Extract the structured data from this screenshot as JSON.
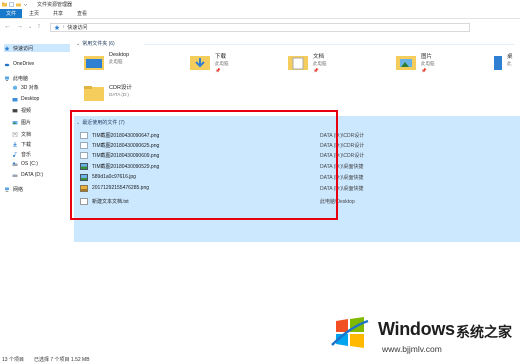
{
  "window": {
    "title": "文件资源管理器"
  },
  "ribbon": {
    "tabs": [
      "文件",
      "主页",
      "共享",
      "查看"
    ]
  },
  "address": {
    "root": "快速访问"
  },
  "sidebar": {
    "items": [
      {
        "label": "快速访问",
        "icon": "star-icon"
      },
      {
        "label": "OneDrive",
        "icon": "cloud-icon"
      },
      {
        "label": "此电脑",
        "icon": "computer-icon"
      },
      {
        "label": "3D 对象",
        "icon": "cube-icon"
      },
      {
        "label": "Desktop",
        "icon": "desktop-folder-icon"
      },
      {
        "label": "视频",
        "icon": "video-folder-icon"
      },
      {
        "label": "图片",
        "icon": "pictures-folder-icon"
      },
      {
        "label": "文档",
        "icon": "documents-folder-icon"
      },
      {
        "label": "下载",
        "icon": "downloads-folder-icon"
      },
      {
        "label": "音乐",
        "icon": "music-folder-icon"
      },
      {
        "label": "OS (C:)",
        "icon": "drive-icon"
      },
      {
        "label": "DATA (D:)",
        "icon": "drive-icon"
      },
      {
        "label": "网络",
        "icon": "network-icon"
      }
    ]
  },
  "frequent": {
    "heading": "常用文件夹 (6)",
    "folders": [
      {
        "name": "Desktop",
        "location": "此电脑",
        "pinned": ""
      },
      {
        "name": "下载",
        "location": "此电脑",
        "pinned": "📌"
      },
      {
        "name": "文档",
        "location": "此电脑",
        "pinned": "📌"
      },
      {
        "name": "图片",
        "location": "此电脑",
        "pinned": "📌"
      },
      {
        "name": "桌",
        "location": "此",
        "pinned": ""
      },
      {
        "name": "CDR设计",
        "location": "DATA (D:)",
        "pinned": ""
      }
    ]
  },
  "recent": {
    "heading": "最近使用的文件 (7)",
    "files": [
      {
        "name": "TIM截图20180430090647.png",
        "location": "DATA (D:)\\CDR设计",
        "type": "img"
      },
      {
        "name": "TIM截图20180430090625.png",
        "location": "DATA (D:)\\CDR设计",
        "type": "img"
      },
      {
        "name": "TIM截图20180430090609.png",
        "location": "DATA (D:)\\CDR设计",
        "type": "img"
      },
      {
        "name": "TIM截图20180430090529.png",
        "location": "DATA (D:)\\桌面快捷",
        "type": "img"
      },
      {
        "name": "589d1a0c97616.jpg",
        "location": "DATA (D:)\\桌面快捷",
        "type": "jpg"
      },
      {
        "name": "20171292155476285.png",
        "location": "DATA (D:)\\桌面快捷",
        "type": "jpg"
      },
      {
        "name": "新建文本文档.txt",
        "location": "此电脑\\Desktop",
        "type": "txt"
      }
    ]
  },
  "status": {
    "count": "13 个项目",
    "selected": "已选择 7 个项目  1.52 MB"
  },
  "watermark": {
    "title": "Windows",
    "title_cn": "系统之家",
    "url": "www.bjjmlv.com"
  },
  "colors": {
    "selection": "#cce8ff",
    "highlight_box": "#e60012",
    "ribbon_file": "#1979ca"
  }
}
